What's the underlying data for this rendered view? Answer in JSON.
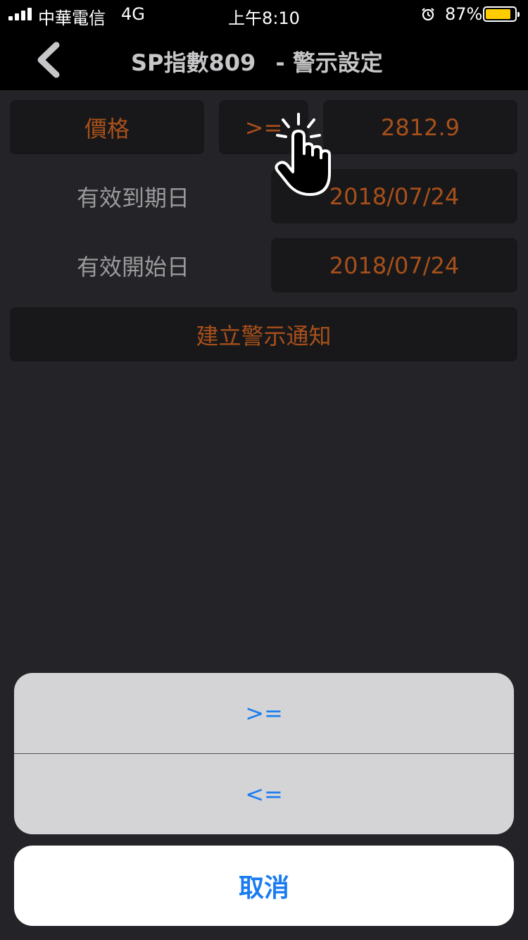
{
  "status_bar": {
    "carrier": "中華電信",
    "network": "4G",
    "time": "上午8:10",
    "battery_percent": "87%",
    "battery_level": 0.87,
    "icons": [
      "signal-icon",
      "alarm-icon",
      "battery-icon"
    ]
  },
  "nav": {
    "title_main": "SP指數809",
    "title_sub": "- 警示設定",
    "back_icon": "chevron-left-icon"
  },
  "form": {
    "field_label": "價格",
    "operator": ">=",
    "price": "2812.9",
    "expiry_label": "有效到期日",
    "expiry_date": "2018/07/24",
    "start_label": "有效開始日",
    "start_date": "2018/07/24",
    "create_button": "建立警示通知"
  },
  "action_sheet": {
    "options": [
      ">=",
      "<="
    ],
    "cancel": "取消"
  },
  "overlay": {
    "icon": "tap-hand-icon"
  },
  "colors": {
    "accent_orange": "#a8501a",
    "ios_blue": "#1a7cf0",
    "battery_yellow": "#ffcc00",
    "background": "#242428"
  }
}
